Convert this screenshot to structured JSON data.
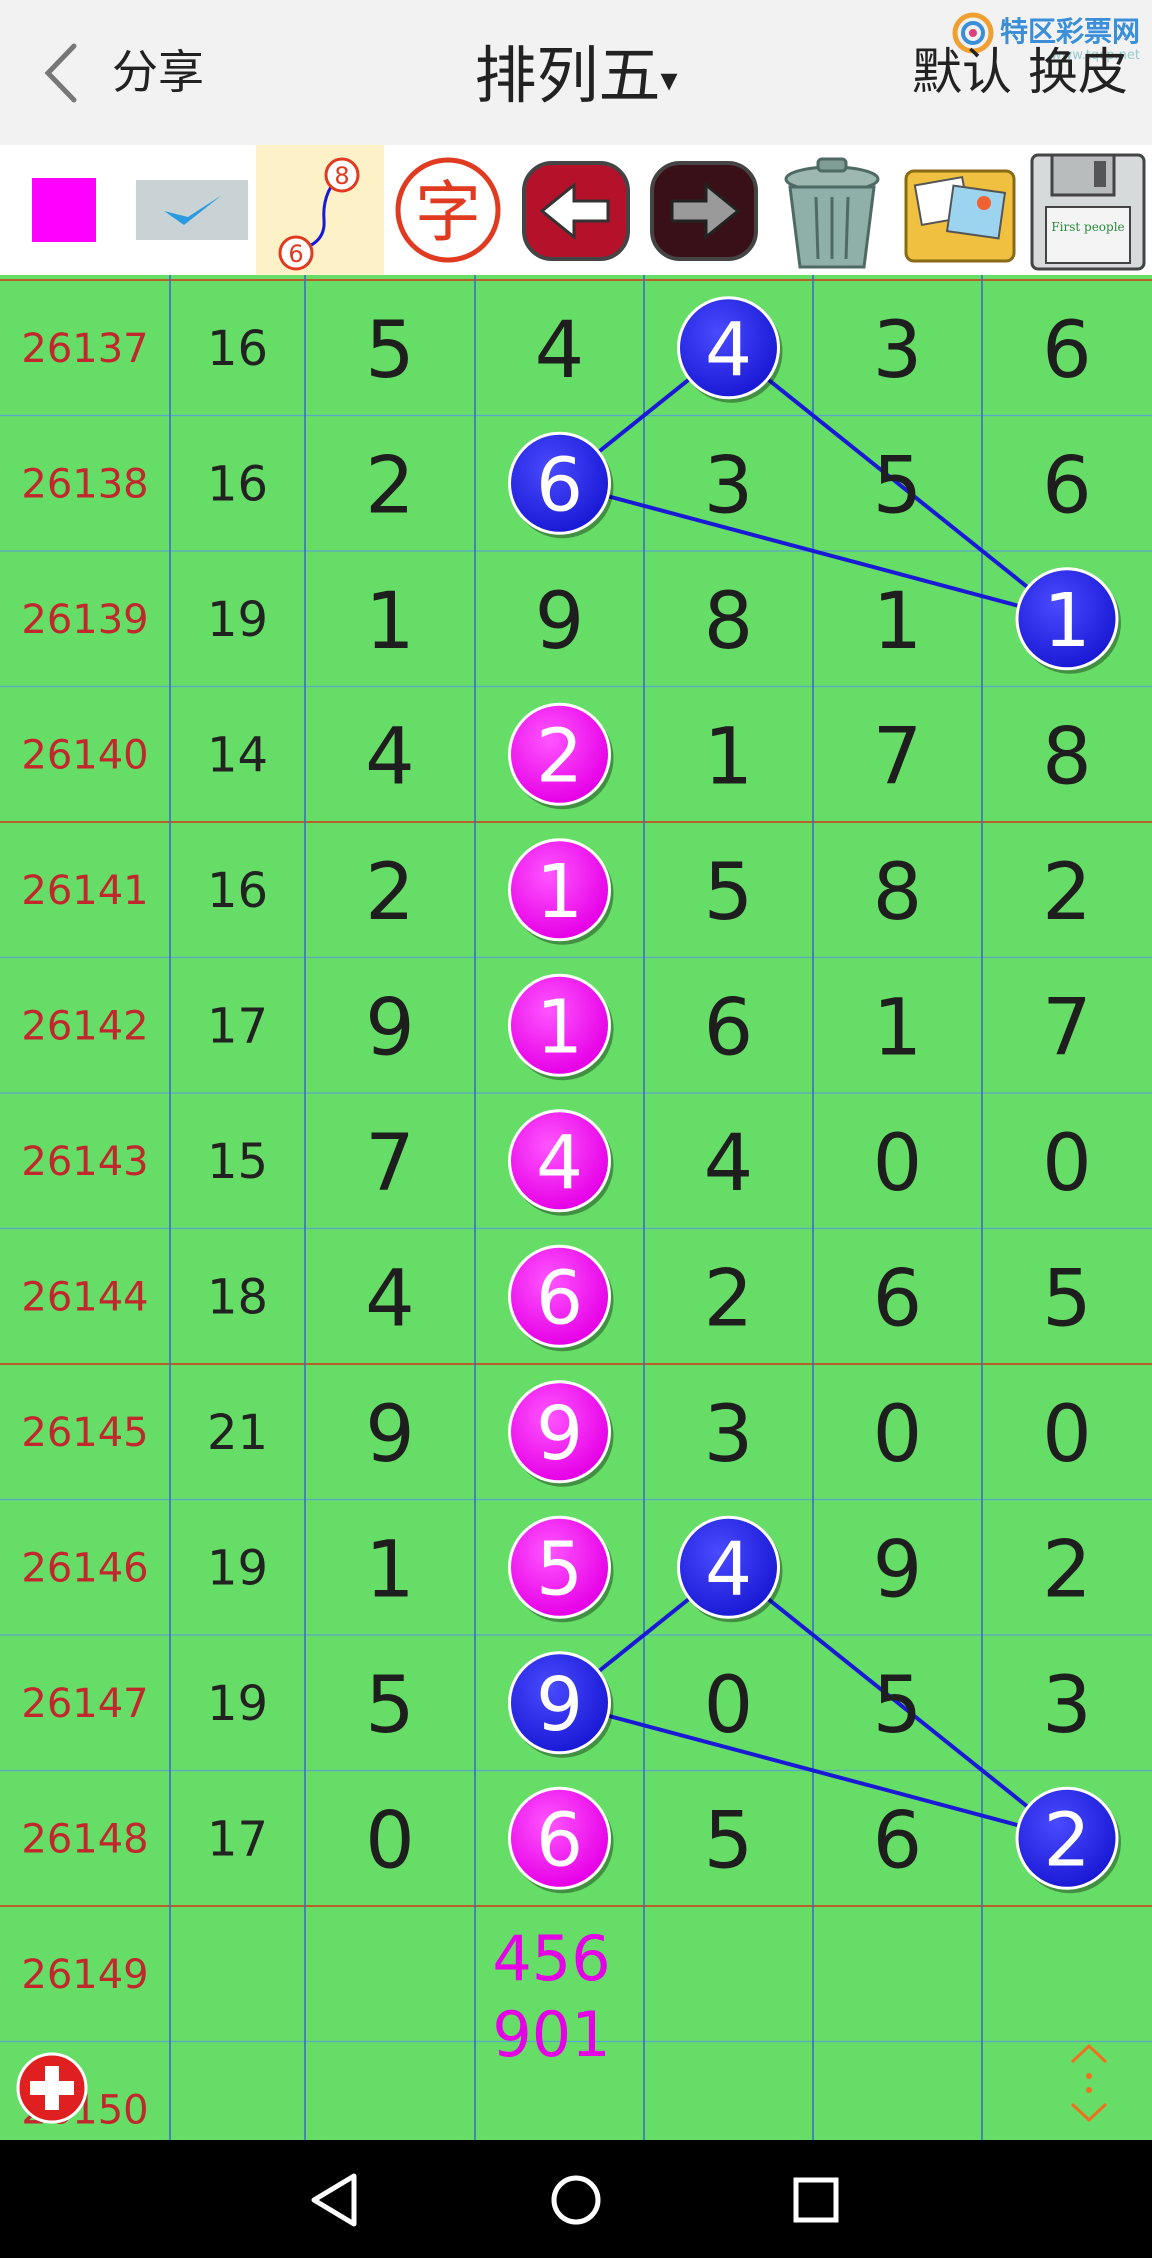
{
  "header": {
    "share_label": "分享",
    "title": "排列五",
    "title_caret": "▾",
    "default_label": "默认",
    "skin_label": "换皮",
    "watermark_text": "特区彩票网",
    "watermark_sub": "www.tqcp.net"
  },
  "toolbar": {
    "tools": [
      {
        "name": "color-swatch-tool",
        "icon": "magenta-square-icon"
      },
      {
        "name": "checkmark-tool",
        "icon": "check-icon"
      },
      {
        "name": "connect-line-tool",
        "icon": "line-connect-icon",
        "num_a": "8",
        "num_b": "6"
      },
      {
        "name": "text-tool",
        "icon": "character-icon",
        "label": "字"
      },
      {
        "name": "undo-tool",
        "icon": "arrow-left-icon"
      },
      {
        "name": "redo-tool",
        "icon": "arrow-right-icon"
      },
      {
        "name": "delete-tool",
        "icon": "trash-icon"
      },
      {
        "name": "gallery-tool",
        "icon": "photos-icon"
      },
      {
        "name": "save-tool",
        "icon": "floppy-disk-icon",
        "label": "First people"
      }
    ]
  },
  "colors": {
    "grid_bg": "#66dd66",
    "issue_text": "#c1272d",
    "blue_ball": "#1a1ad6",
    "magenta_ball": "#e600e6",
    "prediction": "#e600e6",
    "line": "#1a1ad6"
  },
  "rows": [
    {
      "issue": "26137",
      "sum": "16",
      "digits": [
        "5",
        "4",
        "4",
        "3",
        "6"
      ],
      "balls": [
        {
          "col": 2,
          "color": "blue"
        }
      ]
    },
    {
      "issue": "26138",
      "sum": "16",
      "digits": [
        "2",
        "6",
        "3",
        "5",
        "6"
      ],
      "balls": [
        {
          "col": 1,
          "color": "blue"
        }
      ]
    },
    {
      "issue": "26139",
      "sum": "19",
      "digits": [
        "1",
        "9",
        "8",
        "1",
        "1"
      ],
      "balls": [
        {
          "col": 4,
          "color": "blue"
        }
      ]
    },
    {
      "issue": "26140",
      "sum": "14",
      "digits": [
        "4",
        "2",
        "1",
        "7",
        "8"
      ],
      "balls": [
        {
          "col": 1,
          "color": "magenta"
        }
      ]
    },
    {
      "issue": "26141",
      "sum": "16",
      "digits": [
        "2",
        "1",
        "5",
        "8",
        "2"
      ],
      "balls": [
        {
          "col": 1,
          "color": "magenta"
        }
      ]
    },
    {
      "issue": "26142",
      "sum": "17",
      "digits": [
        "9",
        "1",
        "6",
        "1",
        "7"
      ],
      "balls": [
        {
          "col": 1,
          "color": "magenta"
        }
      ]
    },
    {
      "issue": "26143",
      "sum": "15",
      "digits": [
        "7",
        "4",
        "4",
        "0",
        "0"
      ],
      "balls": [
        {
          "col": 1,
          "color": "magenta"
        }
      ]
    },
    {
      "issue": "26144",
      "sum": "18",
      "digits": [
        "4",
        "6",
        "2",
        "6",
        "5"
      ],
      "balls": [
        {
          "col": 1,
          "color": "magenta"
        }
      ]
    },
    {
      "issue": "26145",
      "sum": "21",
      "digits": [
        "9",
        "9",
        "3",
        "0",
        "0"
      ],
      "balls": [
        {
          "col": 1,
          "color": "magenta"
        }
      ]
    },
    {
      "issue": "26146",
      "sum": "19",
      "digits": [
        "1",
        "5",
        "4",
        "9",
        "2"
      ],
      "balls": [
        {
          "col": 1,
          "color": "magenta"
        },
        {
          "col": 2,
          "color": "blue"
        }
      ]
    },
    {
      "issue": "26147",
      "sum": "19",
      "digits": [
        "5",
        "9",
        "0",
        "5",
        "3"
      ],
      "balls": [
        {
          "col": 1,
          "color": "blue"
        }
      ]
    },
    {
      "issue": "26148",
      "sum": "17",
      "digits": [
        "0",
        "6",
        "5",
        "6",
        "2"
      ],
      "balls": [
        {
          "col": 1,
          "color": "magenta"
        },
        {
          "col": 4,
          "color": "blue"
        }
      ]
    },
    {
      "issue": "26149",
      "sum": "",
      "digits": [
        "",
        "",
        "",
        "",
        ""
      ],
      "balls": []
    },
    {
      "issue": "26150",
      "sum": "",
      "digits": [
        "",
        "",
        "",
        "",
        ""
      ],
      "balls": []
    }
  ],
  "connections": [
    {
      "points": [
        [
          0,
          2
        ],
        [
          1,
          1
        ],
        [
          2,
          4
        ],
        [
          0,
          2
        ]
      ]
    },
    {
      "points": [
        [
          9,
          2
        ],
        [
          10,
          1
        ],
        [
          11,
          4
        ],
        [
          9,
          2
        ]
      ]
    }
  ],
  "prediction": {
    "row": 12,
    "col": 1,
    "lines": [
      "456",
      "901"
    ]
  },
  "fab": {
    "icon": "add-icon"
  },
  "scroll_icon": "scroll-arrows-icon",
  "navbar": [
    {
      "name": "nav-back-button",
      "icon": "triangle-back-icon"
    },
    {
      "name": "nav-home-button",
      "icon": "circle-home-icon"
    },
    {
      "name": "nav-recents-button",
      "icon": "square-recents-icon"
    }
  ]
}
